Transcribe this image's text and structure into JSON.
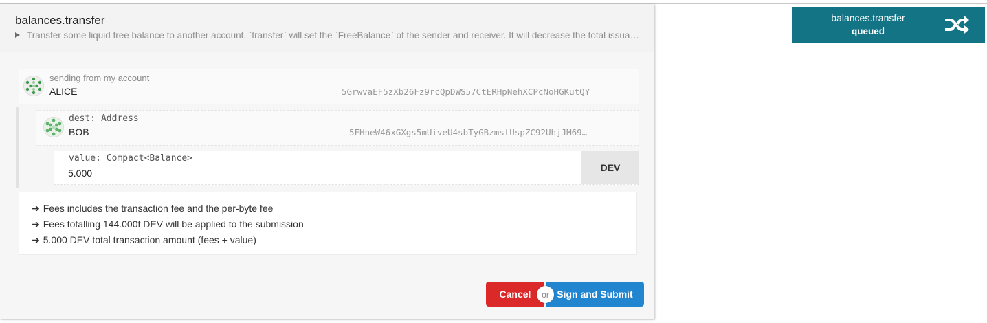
{
  "modal": {
    "title": "balances.transfer",
    "description": "Transfer some liquid free balance to another account. `transfer` will set the `FreeBalance` of the sender and receiver. It will decrease the total issuance of the system by the `TransferFee`."
  },
  "sender": {
    "label": "sending from my account",
    "name": "ALICE",
    "address": "5GrwvaEF5zXb26Fz9rcQpDWS57CtERHpNehXCPcNoHGKutQY"
  },
  "dest": {
    "label": "dest: Address",
    "name": "BOB",
    "address": "5FHneW46xGXgs5mUiveU4sbTyGBzmstUspZC92UhjJM69…"
  },
  "value": {
    "label": "value: Compact<Balance>",
    "amount": "5.000",
    "unit": "DEV"
  },
  "fees": {
    "lines": [
      "Fees includes the transaction fee and the per-byte fee",
      "Fees totalling 144.000f DEV will be applied to the submission",
      "5.000 DEV total transaction amount (fees + value)"
    ]
  },
  "actions": {
    "cancel": "Cancel",
    "or": "or",
    "submit": "Sign and Submit"
  },
  "toast": {
    "title": "balances.transfer",
    "status": "queued",
    "icon": "shuffle-icon"
  },
  "colors": {
    "cancel": "#db2828",
    "submit": "#2185d0",
    "toast": "#137486"
  }
}
